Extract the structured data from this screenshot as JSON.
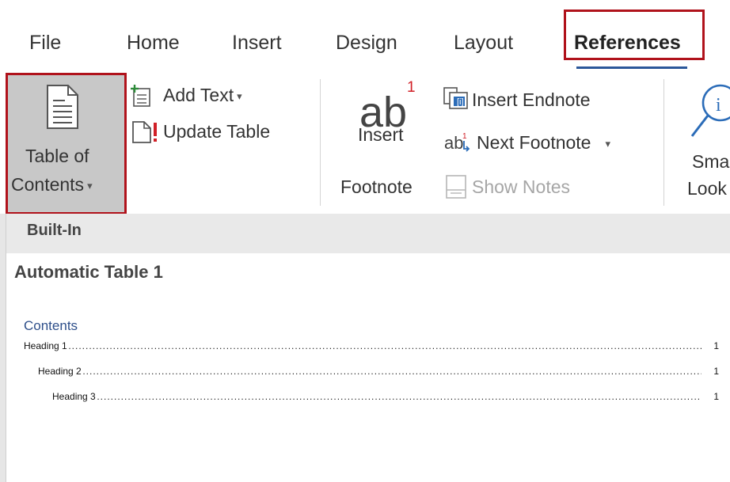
{
  "tabs": [
    "File",
    "Home",
    "Insert",
    "Design",
    "Layout",
    "References"
  ],
  "active_tab": "References",
  "ribbon": {
    "toc_button": {
      "line1": "Table of",
      "line2": "Contents",
      "caret": "▾"
    },
    "add_text": {
      "label": "Add Text",
      "caret": "▾"
    },
    "update_table": {
      "label": "Update Table"
    },
    "insert_footnote": {
      "glyph": "ab",
      "superscript": "1",
      "line1": "Insert",
      "line2": "Footnote"
    },
    "insert_endnote": {
      "label": "Insert Endnote"
    },
    "next_footnote": {
      "label": "Next Footnote",
      "caret": "▾"
    },
    "show_notes": {
      "label": "Show Notes"
    },
    "smart_lookup": {
      "line1": "Sma",
      "line2": "Look"
    }
  },
  "gallery": {
    "section_header": "Built-In",
    "item_title": "Automatic Table 1",
    "preview": {
      "heading": "Contents",
      "entries": [
        {
          "label": "Heading 1",
          "page": "1"
        },
        {
          "label": "Heading 2",
          "page": "1"
        },
        {
          "label": "Heading 3",
          "page": "1"
        }
      ]
    }
  },
  "colors": {
    "highlight_box": "#b0121b",
    "active_underline": "#2b579a",
    "contents_heading": "#2e4f8a"
  }
}
